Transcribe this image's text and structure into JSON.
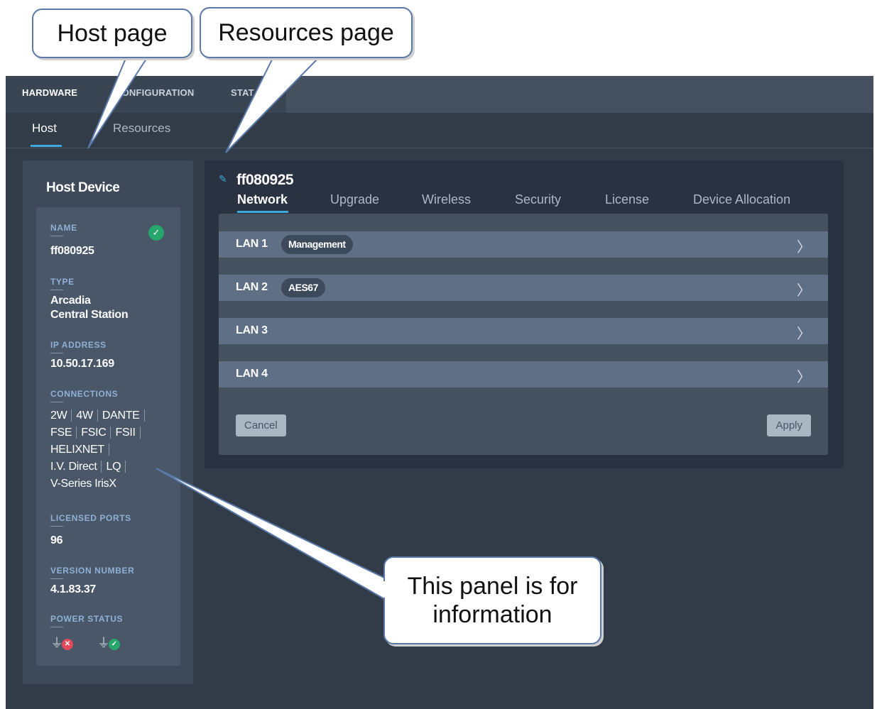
{
  "callouts": {
    "host_page": "Host page",
    "resources_page": "Resources page",
    "info_line1": "This panel is for",
    "info_line2": "information"
  },
  "top_tabs": [
    "HARDWARE",
    "CONFIGURATION",
    "STAT"
  ],
  "sub_tabs": [
    "Host",
    "Resources"
  ],
  "host": {
    "title": "Host Device",
    "name_label": "NAME",
    "name": "ff080925",
    "type_label": "TYPE",
    "type_line1": "Arcadia",
    "type_line2": "Central Station",
    "ip_label": "IP ADDRESS",
    "ip": "10.50.17.169",
    "connections_label": "CONNECTIONS",
    "connections": [
      "2W",
      "4W",
      "DANTE",
      "FSE",
      "FSIC",
      "FSII",
      "HELIXNET",
      "I.V. Direct",
      "LQ",
      "V-Series IrisX"
    ],
    "licensed_ports_label": "LICENSED PORTS",
    "licensed_ports": "96",
    "version_label": "VERSION NUMBER",
    "version": "4.1.83.37",
    "power_label": "POWER STATUS"
  },
  "resources": {
    "device": "ff080925",
    "tabs": [
      "Network",
      "Upgrade",
      "Wireless",
      "Security",
      "License",
      "Device Allocation"
    ],
    "lans": [
      {
        "label": "LAN 1",
        "chip": "Management"
      },
      {
        "label": "LAN 2",
        "chip": "AES67"
      },
      {
        "label": "LAN 3",
        "chip": ""
      },
      {
        "label": "LAN 4",
        "chip": ""
      }
    ],
    "cancel": "Cancel",
    "apply": "Apply"
  },
  "colors": {
    "accent": "#3fa7dc",
    "ok": "#26a66b",
    "error": "#e04a5a"
  }
}
